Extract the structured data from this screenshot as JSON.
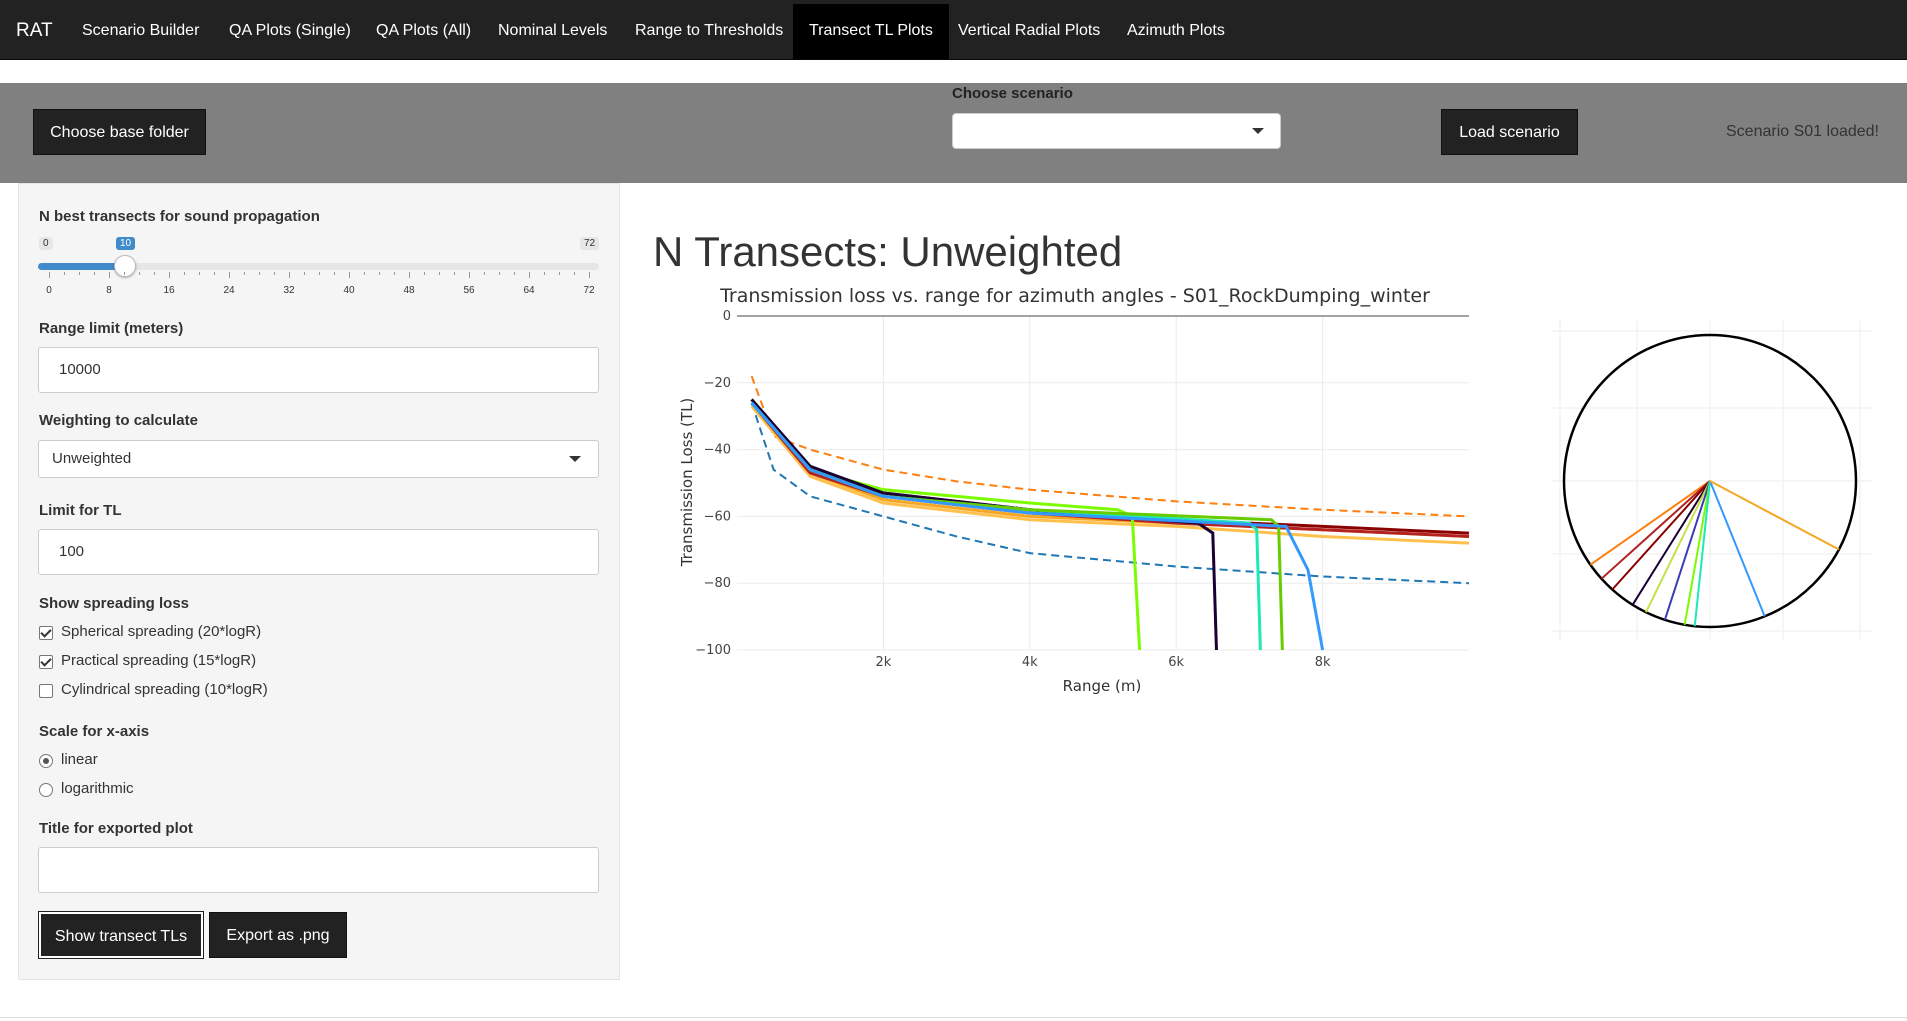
{
  "navbar": {
    "brand": "RAT",
    "tabs": [
      "Scenario Builder",
      "QA Plots (Single)",
      "QA Plots (All)",
      "Nominal Levels",
      "Range to Thresholds",
      "Transect TL Plots",
      "Vertical Radial Plots",
      "Azimuth Plots"
    ],
    "active_tab": "Transect TL Plots"
  },
  "scenario_bar": {
    "choose_base_folder": "Choose base folder",
    "choose_scenario_label": "Choose scenario",
    "scenario_value": "",
    "load_scenario": "Load scenario",
    "status": "Scenario S01 loaded!"
  },
  "sidebar": {
    "n_best_label": "N best transects for sound propagation",
    "slider": {
      "min": "0",
      "max": "72",
      "value": "10",
      "ticks": [
        "0",
        "8",
        "16",
        "24",
        "32",
        "40",
        "48",
        "56",
        "64",
        "72"
      ]
    },
    "range_limit_label": "Range limit (meters)",
    "range_limit_value": "10000",
    "weighting_label": "Weighting to calculate",
    "weighting_value": "Unweighted",
    "tl_limit_label": "Limit for TL",
    "tl_limit_value": "100",
    "spreading_label": "Show spreading loss",
    "spreading_options": [
      {
        "label": "Spherical spreading (20*logR)",
        "checked": true
      },
      {
        "label": "Practical spreading (15*logR)",
        "checked": true
      },
      {
        "label": "Cylindrical spreading (10*logR)",
        "checked": false
      }
    ],
    "scale_label": "Scale for x-axis",
    "scale_options": [
      {
        "label": "linear",
        "selected": true
      },
      {
        "label": "logarithmic",
        "selected": false
      }
    ],
    "export_title_label": "Title for exported plot",
    "export_title_value": "",
    "show_button": "Show transect TLs",
    "export_button": "Export as .png"
  },
  "main": {
    "title": "N Transects: Unweighted"
  },
  "chart_data": {
    "type": "line",
    "title": "Transmission loss vs. range for azimuth angles - S01_RockDumping_winter",
    "xlabel": "Range (m)",
    "ylabel": "Transmission Loss (TL)",
    "xlim": [
      0,
      10000
    ],
    "ylim": [
      -100,
      0
    ],
    "xticks": [
      2000,
      4000,
      6000,
      8000
    ],
    "xtick_labels": [
      "2k",
      "4k",
      "6k",
      "8k"
    ],
    "yticks": [
      0,
      -20,
      -40,
      -60,
      -80,
      -100
    ],
    "ytick_labels": [
      "0",
      "−20",
      "−40",
      "−60",
      "−80",
      "−100"
    ],
    "grid": true,
    "series": [
      {
        "style": "dashed",
        "color": "#ff7f0e",
        "x": [
          200,
          500,
          1000,
          2000,
          3000,
          4000,
          6000,
          8000,
          10000
        ],
        "y": [
          -18,
          -36,
          -40,
          -46,
          -49.5,
          -52,
          -55.5,
          -58,
          -60
        ]
      },
      {
        "style": "dashed",
        "color": "#1f77b4",
        "x": [
          200,
          500,
          1000,
          2000,
          3000,
          4000,
          6000,
          8000,
          10000
        ],
        "y": [
          -26,
          -46,
          -54,
          -60,
          -66,
          -71,
          -75,
          -78,
          -80
        ]
      },
      {
        "color": "#f5a623",
        "x": [
          200,
          1000,
          2000,
          4000,
          6000,
          8000,
          10000
        ],
        "y": [
          -26,
          -47,
          -55,
          -60,
          -62,
          -64,
          -66
        ]
      },
      {
        "color": "#ffc04d",
        "x": [
          200,
          1000,
          2000,
          4000,
          6000,
          8000,
          10000
        ],
        "y": [
          -27,
          -48,
          -56,
          -61,
          -63,
          -66,
          -68
        ]
      },
      {
        "color": "#8b0000",
        "x": [
          200,
          1000,
          2000,
          4000,
          6000,
          8000,
          10000
        ],
        "y": [
          -25,
          -46,
          -53,
          -58,
          -61,
          -63,
          -65
        ]
      },
      {
        "color": "#b22222",
        "x": [
          200,
          1000,
          2000,
          4000,
          6000,
          8000,
          10000
        ],
        "y": [
          -26,
          -47,
          -54,
          -59,
          -62,
          -64,
          -66
        ]
      },
      {
        "color": "#7cfc00",
        "x": [
          200,
          1000,
          2000,
          4000,
          5200,
          5400,
          5500
        ],
        "y": [
          -25,
          -46,
          -52,
          -56,
          -58,
          -60,
          -100
        ]
      },
      {
        "color": "#1b0033",
        "x": [
          200,
          1000,
          2000,
          4000,
          6300,
          6500,
          6550
        ],
        "y": [
          -25,
          -45,
          -53,
          -58,
          -62,
          -65,
          -100
        ]
      },
      {
        "color": "#1de9b6",
        "x": [
          200,
          1000,
          2000,
          4000,
          7000,
          7100,
          7150
        ],
        "y": [
          -26,
          -46,
          -54,
          -58,
          -62,
          -64,
          -100
        ]
      },
      {
        "color": "#66cc00",
        "x": [
          200,
          1000,
          2000,
          4000,
          7300,
          7400,
          7450
        ],
        "y": [
          -26,
          -46,
          -54,
          -58,
          -61,
          -63,
          -100
        ]
      },
      {
        "color": "#3399ff",
        "x": [
          200,
          1000,
          2000,
          4000,
          7500,
          7800,
          8000
        ],
        "y": [
          -26,
          -46,
          -54,
          -59,
          -63,
          -76,
          -100
        ]
      }
    ]
  },
  "polar_data": {
    "spokes": [
      {
        "angle": 235,
        "color": "#ff7f0e"
      },
      {
        "angle": 228,
        "color": "#b22222"
      },
      {
        "angle": 222,
        "color": "#8b0000"
      },
      {
        "angle": 212,
        "color": "#1b0033"
      },
      {
        "angle": 206,
        "color": "#c6e048"
      },
      {
        "angle": 198,
        "color": "#3b3bb5"
      },
      {
        "angle": 190,
        "color": "#7cfc00"
      },
      {
        "angle": 186,
        "color": "#1de9b6"
      },
      {
        "angle": 158,
        "color": "#3399ff"
      },
      {
        "angle": 118,
        "color": "#f5a623"
      }
    ]
  }
}
